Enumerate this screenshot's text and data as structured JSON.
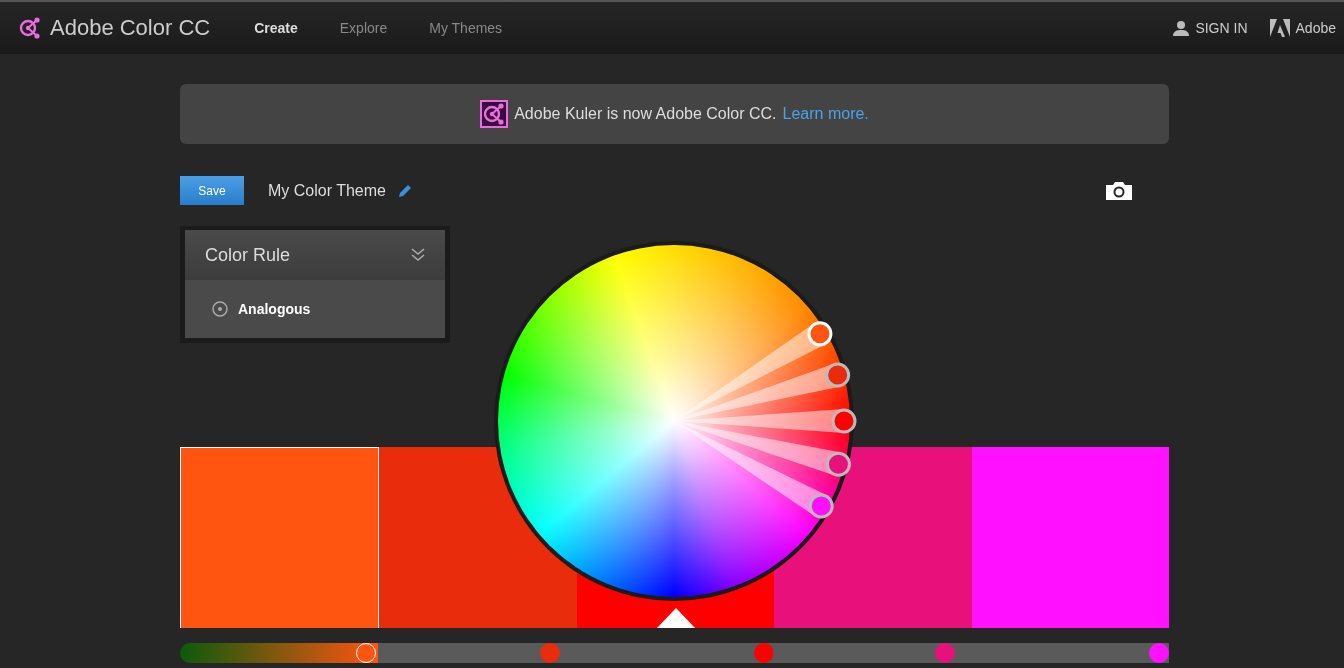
{
  "header": {
    "brand": "Adobe Color CC",
    "nav": [
      {
        "label": "Create",
        "selected": true
      },
      {
        "label": "Explore",
        "selected": false
      },
      {
        "label": "My Themes",
        "selected": false
      }
    ],
    "sign_in": "SIGN IN",
    "adobe": "Adobe"
  },
  "banner": {
    "message": "Adobe Kuler is now Adobe Color CC.",
    "link": "Learn more."
  },
  "toolbar": {
    "save": "Save",
    "theme_name": "My Color Theme"
  },
  "color_rule": {
    "title": "Color Rule",
    "option": "Analogous"
  },
  "swatches": [
    {
      "color": "#ff5511",
      "selected": true,
      "base": false,
      "level": 0.94
    },
    {
      "color": "#e82c0c",
      "selected": false,
      "base": false,
      "level": 0.87
    },
    {
      "color": "#ff0000",
      "selected": false,
      "base": true,
      "level": 0.95
    },
    {
      "color": "#e8107a",
      "selected": false,
      "base": false,
      "level": 0.87
    },
    {
      "color": "#ff11ff",
      "selected": false,
      "base": false,
      "level": 0.95
    }
  ]
}
